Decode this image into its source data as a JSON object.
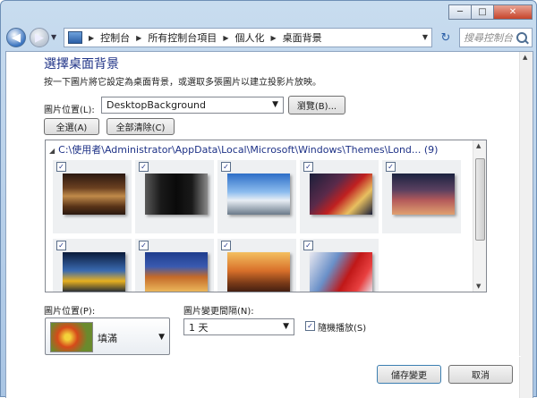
{
  "titlebar": {
    "minimize_label": "─",
    "maximize_label": "□",
    "close_label": "✕"
  },
  "nav": {
    "back_label": "◀",
    "forward_label": "▶",
    "breadcrumb": [
      "控制台",
      "所有控制台項目",
      "個人化",
      "桌面背景"
    ],
    "refresh_label": "↻",
    "search_placeholder": "搜尋控制台"
  },
  "content": {
    "heading": "選擇桌面背景",
    "subtext": "按一下圖片將它設定為桌面背景，或選取多張圖片以建立投影片放映。",
    "location_label": "圖片位置(L):",
    "location_value": "DesktopBackground",
    "browse_label": "瀏覽(B)...",
    "select_all_label": "全選(A)",
    "clear_all_label": "全部清除(C)",
    "gallery_path": "C:\\使用者\\Administrator\\AppData\\Local\\Microsoft\\Windows\\Themes\\Lond... (9)",
    "images": [
      {
        "name": "cathedral-interior",
        "checked": true,
        "colors": [
          "#3a2014",
          "#8a5a2e",
          "#c99a55"
        ]
      },
      {
        "name": "black-door",
        "checked": true,
        "colors": [
          "#1a1a1a",
          "#4a4a4a",
          "#a0a0a0"
        ]
      },
      {
        "name": "stadium-arch",
        "checked": true,
        "colors": [
          "#2d6ec7",
          "#9ccaf4",
          "#e8eef5"
        ]
      },
      {
        "name": "city-street-night",
        "checked": true,
        "colors": [
          "#1a1f3a",
          "#a02020",
          "#e8c060"
        ]
      },
      {
        "name": "london-aerial-dusk",
        "checked": true,
        "colors": [
          "#1c2340",
          "#b45a5a",
          "#e0a070"
        ]
      },
      {
        "name": "taxi-sign",
        "checked": true,
        "colors": [
          "#0a1a3a",
          "#3a6ab0",
          "#e8b020"
        ]
      },
      {
        "name": "royal-albert-hall",
        "checked": true,
        "colors": [
          "#1e3c8c",
          "#c46a2a",
          "#f0c060"
        ]
      },
      {
        "name": "london-eye-sunset",
        "checked": true,
        "colors": [
          "#3a1a10",
          "#d8702a",
          "#f4c060"
        ]
      },
      {
        "name": "red-bus-bigben",
        "checked": true,
        "colors": [
          "#c01818",
          "#e8e8f0",
          "#6a90c8"
        ]
      }
    ],
    "position_label": "圖片位置(P):",
    "position_value": "填滿",
    "interval_label": "圖片變更間隔(N):",
    "interval_value": "1 天",
    "shuffle_label": "隨機播放(S)",
    "save_label": "儲存變更",
    "cancel_label": "取消"
  }
}
